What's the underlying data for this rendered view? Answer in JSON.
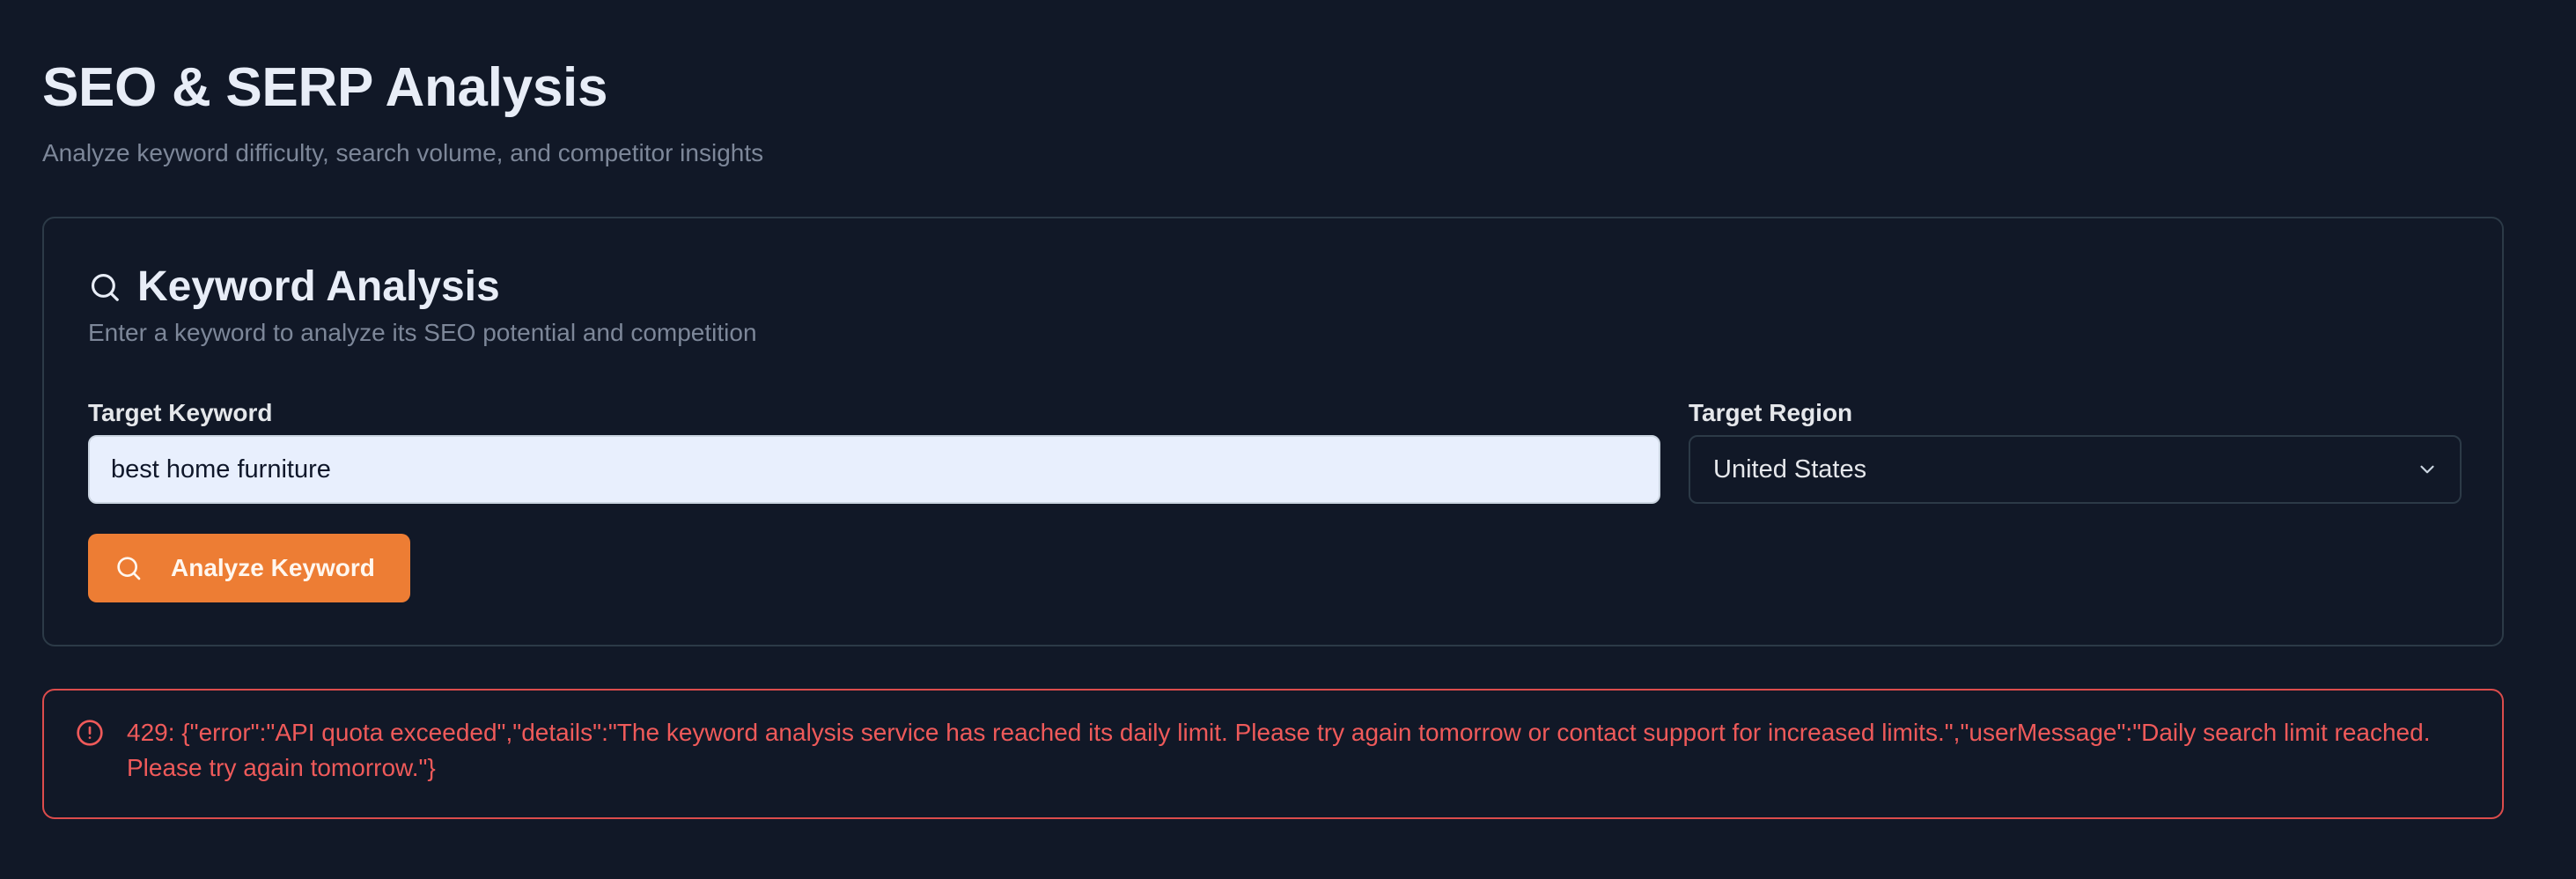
{
  "header": {
    "title": "SEO & SERP Analysis",
    "subtitle": "Analyze keyword difficulty, search volume, and competitor insights"
  },
  "keyword_card": {
    "title": "Keyword Analysis",
    "title_icon": "search-icon",
    "description": "Enter a keyword to analyze its SEO potential and competition",
    "keyword_label": "Target Keyword",
    "keyword_value": "best home furniture",
    "region_label": "Target Region",
    "region_value": "United States",
    "region_icon": "chevron-down-icon",
    "analyze_button_label": "Analyze Keyword",
    "analyze_button_icon": "search-icon"
  },
  "error": {
    "icon": "alert-circle-icon",
    "message": "429: {\"error\":\"API quota exceeded\",\"details\":\"The keyword analysis service has reached its daily limit. Please try again tomorrow or contact support for increased limits.\",\"userMessage\":\"Daily search limit reached. Please try again tomorrow.\"}"
  },
  "colors": {
    "background": "#111827",
    "accent": "#ed7d34",
    "error": "#ef5a5a",
    "border": "#2c3a47"
  }
}
